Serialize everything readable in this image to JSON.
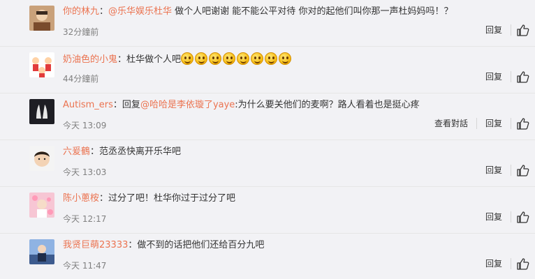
{
  "comments": [
    {
      "user": "你的林九",
      "segments": [
        {
          "type": "mention",
          "text": "@乐华娱乐杜华"
        },
        {
          "type": "text",
          "text": " 做个人吧谢谢 能不能公平对待 你对的起他们叫你那一声杜妈妈吗！？"
        }
      ],
      "time": "32分鐘前",
      "actions": [
        "回复"
      ]
    },
    {
      "user": "奶油色的小鬼",
      "segments": [
        {
          "type": "text",
          "text": "杜华做个人吧"
        }
      ],
      "emoji_count": 8,
      "emoji_name": "smile-emoji",
      "time": "44分鐘前",
      "actions": [
        "回复"
      ]
    },
    {
      "user": "Autism_ers",
      "segments": [
        {
          "type": "text",
          "text": "回复"
        },
        {
          "type": "mention",
          "text": "@哈哈是李依璇了yaye"
        },
        {
          "type": "text",
          "text": ":为什么要关他们的麦啊？路人看着也是挺心疼"
        }
      ],
      "time": "今天 13:09",
      "actions": [
        "查看對話",
        "回复"
      ]
    },
    {
      "user": "六爰鶴",
      "segments": [
        {
          "type": "text",
          "text": "范丞丞快离开乐华吧"
        }
      ],
      "time": "今天 13:03",
      "actions": [
        "回复"
      ]
    },
    {
      "user": "陈小蔥桉",
      "segments": [
        {
          "type": "text",
          "text": "过分了吧！杜华你过于过分了吧"
        }
      ],
      "time": "今天 12:17",
      "actions": [
        "回复"
      ]
    },
    {
      "user": "我贤巨萌23333",
      "segments": [
        {
          "type": "text",
          "text": "做不到的话把他们还给百分九吧"
        }
      ],
      "time": "今天 11:47",
      "actions": [
        "回复"
      ]
    }
  ],
  "separator": "：",
  "like_icon": "thumbs-up-icon",
  "colors": {
    "link": "#eb7350",
    "text": "#333333",
    "muted": "#808080",
    "background": "#f2f2f5"
  }
}
